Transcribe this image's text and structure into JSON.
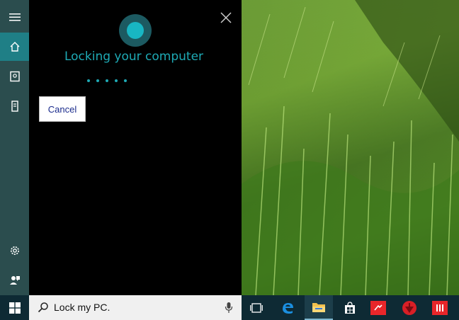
{
  "cortana": {
    "status_text": "Locking your computer",
    "cancel_label": "Cancel"
  },
  "search": {
    "query": "Lock my PC."
  },
  "rail": {
    "items": [
      "menu-icon",
      "home-icon",
      "notebook-icon",
      "device-icon",
      "settings-icon",
      "feedback-icon"
    ]
  },
  "taskbar": {
    "items": [
      "task-view-icon",
      "edge-icon",
      "file-explorer-icon",
      "store-icon",
      "app-red-icon",
      "app-red-circle-icon",
      "app-red-bars-icon"
    ]
  },
  "colors": {
    "accent": "#1eaab5",
    "rail_bg": "#2b4d4e",
    "rail_active": "#1f7f86",
    "taskbar_bg": "#0e2a34"
  }
}
